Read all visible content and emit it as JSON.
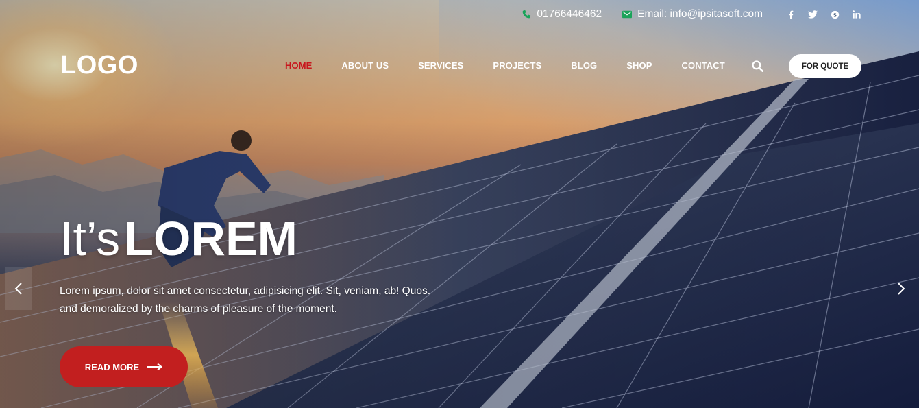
{
  "topbar": {
    "phone": "01766446462",
    "email": "Email: info@ipsitasoft.com",
    "social": [
      "facebook-icon",
      "twitter-icon",
      "skype-icon",
      "linkedin-icon"
    ]
  },
  "header": {
    "logo": "LOGO",
    "nav": [
      {
        "label": "HOME",
        "active": true
      },
      {
        "label": "ABOUT US"
      },
      {
        "label": "SERVICES"
      },
      {
        "label": "PROJECTS"
      },
      {
        "label": "BLOG"
      },
      {
        "label": "SHOP"
      },
      {
        "label": "CONTACT"
      }
    ],
    "quote_label": "FOR QUOTE"
  },
  "slide": {
    "headline_light": "It’s",
    "headline_bold": "LOREM",
    "subtitle_lines": [
      "Lorem ipsum, dolor sit amet consectetur, adipisicing elit. Sit, veniam, ab! Quos.",
      "and demoralized by the charms of pleasure of the moment."
    ],
    "cta_label": "READ MORE"
  },
  "colors": {
    "accent": "#c21f1f",
    "active_nav": "#c8161d",
    "contact_icon": "#1aa35a",
    "quote_button_bg": "#ffffff"
  }
}
